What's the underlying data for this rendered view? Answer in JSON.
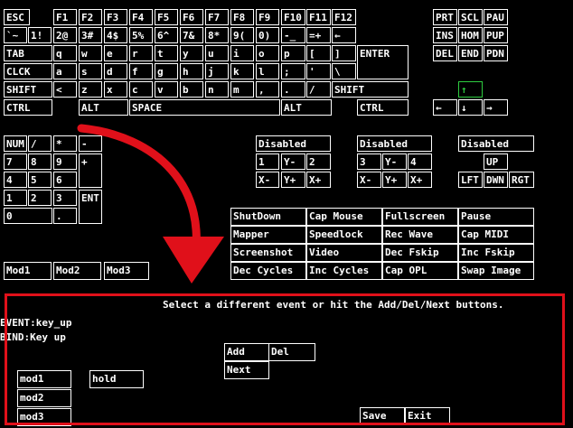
{
  "keys": {
    "esc": "ESC",
    "f1": "F1",
    "f2": "F2",
    "f3": "F3",
    "f4": "F4",
    "f5": "F5",
    "f6": "F6",
    "f7": "F7",
    "f8": "F8",
    "f9": "F9",
    "f10": "F10",
    "f11": "F11",
    "f12": "F12",
    "prt": "PRT",
    "scl": "SCL",
    "pau": "PAU",
    "grave": "`~",
    "k1": "1!",
    "k2": "2@",
    "k3": "3#",
    "k4": "4$",
    "k5": "5%",
    "k6": "6^",
    "k7": "7&",
    "k8": "8*",
    "k9": "9(",
    "k0": "0)",
    "minus": "-_",
    "equal": "=+",
    "bksp": "←",
    "ins": "INS",
    "hom": "HOM",
    "pup": "PUP",
    "tab": "TAB",
    "q": "q",
    "w": "w",
    "e": "e",
    "r": "r",
    "t": "t",
    "y": "y",
    "u": "u",
    "i": "i",
    "o": "o",
    "p": "p",
    "lbr": "[",
    "rbr": "]",
    "enter": "ENTER",
    "del": "DEL",
    "end": "END",
    "pdn": "PDN",
    "clck": "CLCK",
    "a": "a",
    "s": "s",
    "d": "d",
    "f": "f",
    "g": "g",
    "h": "h",
    "j": "j",
    "k": "k",
    "l": "l",
    "semi": ";",
    "quote": "'",
    "bslash": "\\",
    "lshift": "SHIFT",
    "lt": "<",
    "z": "z",
    "x": "x",
    "c": "c",
    "v": "v",
    "b": "b",
    "n": "n",
    "m": "m",
    "comma": ",",
    "period": ".",
    "slash": "/",
    "rshift": "SHIFT",
    "up": "↑",
    "lctrl": "CTRL",
    "lalt": "ALT",
    "space": "SPACE",
    "ralt": "ALT",
    "rctrl": "CTRL",
    "left": "←",
    "down": "↓",
    "right": "→",
    "num": "NUM",
    "kpdiv": "/",
    "kpmul": "*",
    "kpsub": "-",
    "kp7": "7",
    "kp8": "8",
    "kp9": "9",
    "kpadd": "+",
    "kp4": "4",
    "kp5": "5",
    "kp6": "6",
    "kp1": "1",
    "kp2": "2",
    "kp3": "3",
    "kpent": "ENT",
    "kp0": "0",
    "kpdot": "."
  },
  "joysticks": [
    {
      "disabled": "Disabled",
      "b1": "1",
      "ym": "Y-",
      "b2": "2",
      "xm": "X-",
      "yp": "Y+",
      "xp": "X+"
    },
    {
      "disabled": "Disabled",
      "b1": "3",
      "ym": "Y-",
      "b2": "4",
      "xm": "X-",
      "yp": "Y+",
      "xp": "X+"
    }
  ],
  "hat": {
    "disabled": "Disabled",
    "up": "UP",
    "lft": "LFT",
    "dwn": "DWN",
    "rgt": "RGT"
  },
  "mods": {
    "mod1": "Mod1",
    "mod2": "Mod2",
    "mod3": "Mod3"
  },
  "actions": {
    "shutdown": "ShutDown",
    "capmouse": "Cap Mouse",
    "fullscreen": "Fullscreen",
    "pause": "Pause",
    "mapper": "Mapper",
    "speedlock": "Speedlock",
    "recwave": "Rec Wave",
    "capmidi": "Cap MIDI",
    "screenshot": "Screenshot",
    "video": "Video",
    "decfskip": "Dec Fskip",
    "incfskip": "Inc Fskip",
    "deccycles": "Dec Cycles",
    "inccycles": "Inc Cycles",
    "capopl": "Cap OPL",
    "swapimage": "Swap Image"
  },
  "panel": {
    "message": "Select a different event or hit the Add/Del/Next buttons.",
    "event": "EVENT:key_up",
    "bind": "BIND:Key up",
    "add": "Add",
    "del": "Del",
    "next": "Next",
    "mod1": "mod1",
    "mod2": "mod2",
    "mod3": "mod3",
    "hold": "hold",
    "save": "Save",
    "exit": "Exit"
  },
  "colors": {
    "background": "#000000",
    "foreground": "#ffffff",
    "highlight": "#2ecc40",
    "annotation": "#e0101a"
  }
}
